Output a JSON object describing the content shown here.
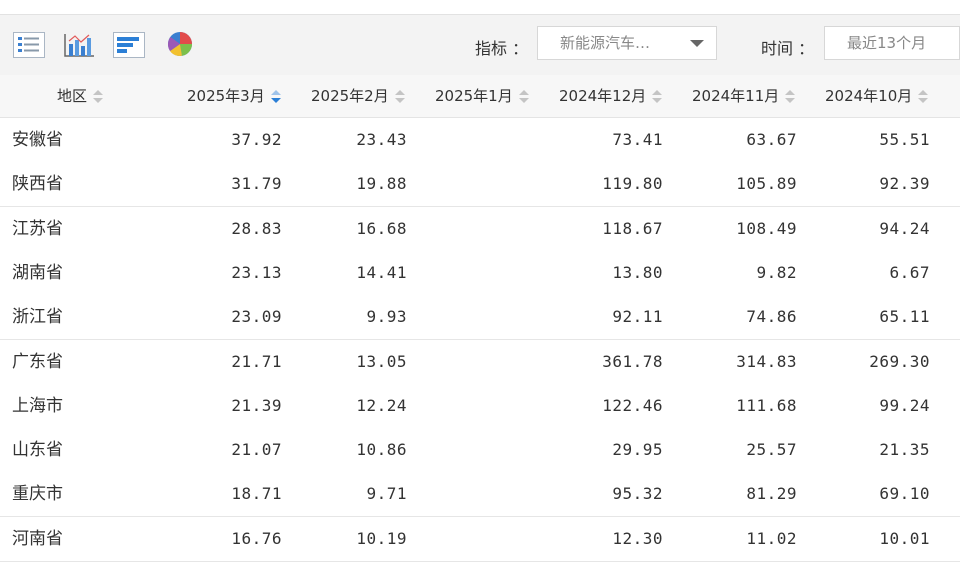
{
  "toolbar": {
    "icons": [
      "list-view-icon",
      "bar-chart-icon",
      "horizontal-bar-icon",
      "pie-chart-icon"
    ],
    "indicator_label": "指标 ：",
    "indicator_value": "新能源汽车…",
    "time_label": "时间 ：",
    "time_value": "最近13个月"
  },
  "table": {
    "headers": [
      "地区",
      "2025年3月",
      "2025年2月",
      "2025年1月",
      "2024年12月",
      "2024年11月",
      "2024年10月"
    ],
    "sorted_column": "2025年3月",
    "rows": [
      {
        "region": "安徽省",
        "values": [
          "37.92",
          "23.43",
          "",
          "73.41",
          "63.67",
          "55.51"
        ]
      },
      {
        "region": "陕西省",
        "values": [
          "31.79",
          "19.88",
          "",
          "119.80",
          "105.89",
          "92.39"
        ]
      },
      {
        "region": "江苏省",
        "values": [
          "28.83",
          "16.68",
          "",
          "118.67",
          "108.49",
          "94.24"
        ]
      },
      {
        "region": "湖南省",
        "values": [
          "23.13",
          "14.41",
          "",
          "13.80",
          "9.82",
          "6.67"
        ]
      },
      {
        "region": "浙江省",
        "values": [
          "23.09",
          "9.93",
          "",
          "92.11",
          "74.86",
          "65.11"
        ]
      },
      {
        "region": "广东省",
        "values": [
          "21.71",
          "13.05",
          "",
          "361.78",
          "314.83",
          "269.30"
        ]
      },
      {
        "region": "上海市",
        "values": [
          "21.39",
          "12.24",
          "",
          "122.46",
          "111.68",
          "99.24"
        ]
      },
      {
        "region": "山东省",
        "values": [
          "21.07",
          "10.86",
          "",
          "29.95",
          "25.57",
          "21.35"
        ]
      },
      {
        "region": "重庆市",
        "values": [
          "18.71",
          "9.71",
          "",
          "95.32",
          "81.29",
          "69.10"
        ]
      },
      {
        "region": "河南省",
        "values": [
          "16.76",
          "10.19",
          "",
          "12.30",
          "11.02",
          "10.01"
        ]
      }
    ]
  },
  "colors": {
    "sort_active": "#2b7fd6",
    "toolbar_bg": "#f3f3f3",
    "header_bg": "#f7f7f7"
  }
}
